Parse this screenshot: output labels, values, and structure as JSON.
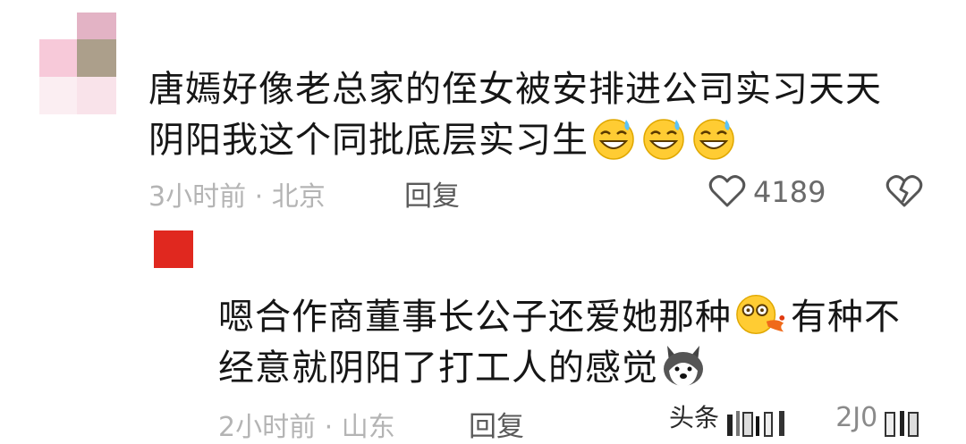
{
  "comments": [
    {
      "text_line1": "唐嫣好像老总家的侄女被安排进公司实习天天",
      "text_line2": "阴阳我这个同批底层实习生",
      "emojis": [
        "sweat-grin-emoji",
        "sweat-grin-emoji",
        "sweat-grin-emoji"
      ],
      "time_location": "3小时前 · 北京",
      "reply_label": "回复",
      "like_count": "4189"
    },
    {
      "text_line1_a": "嗯合作商董事长公子还爱她那种",
      "text_line1_b": "有种不",
      "text_line2": "经意就阴阳了打工人的感觉",
      "emojis": [
        "dizzy-vomit-emoji",
        "husky-dog-emoji"
      ],
      "time_location": "2小时前 · 山东",
      "reply_label": "回复",
      "like_count_partial": "2J0"
    }
  ],
  "watermark": {
    "text": "头条"
  },
  "colors": {
    "text": "#161616",
    "meta": "#b4b4b4",
    "reply": "#5a5a5a",
    "avatar_red": "#e0281f"
  }
}
